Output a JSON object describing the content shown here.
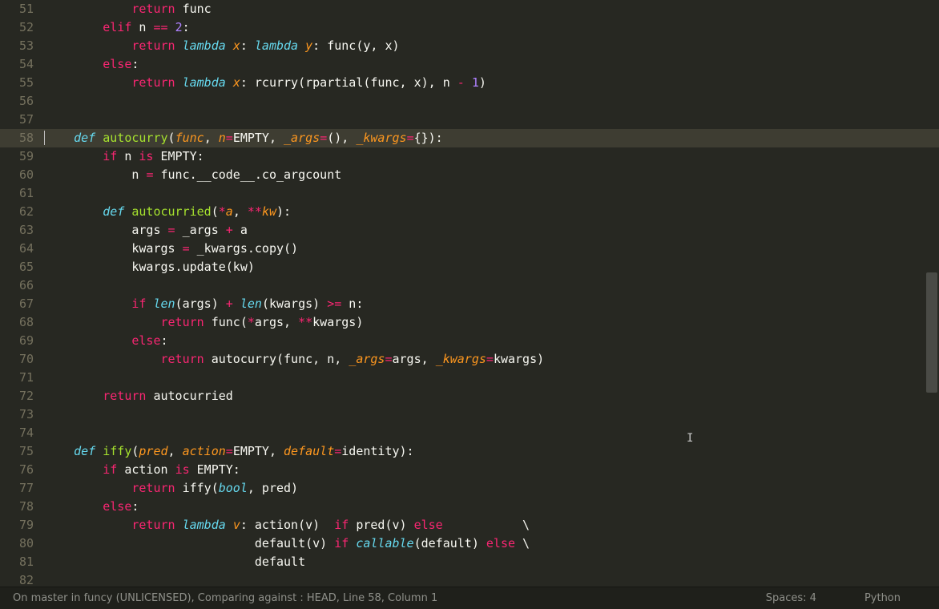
{
  "status": {
    "left": "On master in funcy (UNLICENSED), Comparing against : HEAD, Line 58, Column 1",
    "spaces": "Spaces: 4",
    "syntax": "Python"
  },
  "first_line_number": 51,
  "highlight_line": 58,
  "lines": [
    [
      [
        "pl",
        "            "
      ],
      [
        "kw",
        "return"
      ],
      [
        "pl",
        " func"
      ]
    ],
    [
      [
        "pl",
        "        "
      ],
      [
        "kw",
        "elif"
      ],
      [
        "pl",
        " n "
      ],
      [
        "op",
        "=="
      ],
      [
        "pl",
        " "
      ],
      [
        "nu",
        "2"
      ],
      [
        "pl",
        ":"
      ]
    ],
    [
      [
        "pl",
        "            "
      ],
      [
        "kw",
        "return"
      ],
      [
        "pl",
        " "
      ],
      [
        "kwit",
        "lambda"
      ],
      [
        "pl",
        " "
      ],
      [
        "pr",
        "x"
      ],
      [
        "pl",
        ": "
      ],
      [
        "kwit",
        "lambda"
      ],
      [
        "pl",
        " "
      ],
      [
        "pr",
        "y"
      ],
      [
        "pl",
        ": func(y, x)"
      ]
    ],
    [
      [
        "pl",
        "        "
      ],
      [
        "kw",
        "else"
      ],
      [
        "pl",
        ":"
      ]
    ],
    [
      [
        "pl",
        "            "
      ],
      [
        "kw",
        "return"
      ],
      [
        "pl",
        " "
      ],
      [
        "kwit",
        "lambda"
      ],
      [
        "pl",
        " "
      ],
      [
        "pr",
        "x"
      ],
      [
        "pl",
        ": rcurry(rpartial(func, x), n "
      ],
      [
        "op",
        "-"
      ],
      [
        "pl",
        " "
      ],
      [
        "nu",
        "1"
      ],
      [
        "pl",
        ")"
      ]
    ],
    [
      [
        "pl",
        ""
      ]
    ],
    [
      [
        "pl",
        ""
      ]
    ],
    [
      [
        "pl",
        "    "
      ],
      [
        "kwit",
        "def"
      ],
      [
        "pl",
        " "
      ],
      [
        "fn",
        "autocurry"
      ],
      [
        "pl",
        "("
      ],
      [
        "pr",
        "func"
      ],
      [
        "pl",
        ", "
      ],
      [
        "pr",
        "n"
      ],
      [
        "op",
        "="
      ],
      [
        "pl",
        "EMPTY, "
      ],
      [
        "pr",
        "_args"
      ],
      [
        "op",
        "="
      ],
      [
        "pl",
        "(), "
      ],
      [
        "pr",
        "_kwargs"
      ],
      [
        "op",
        "="
      ],
      [
        "pl",
        "{}):"
      ]
    ],
    [
      [
        "pl",
        "        "
      ],
      [
        "kw",
        "if"
      ],
      [
        "pl",
        " n "
      ],
      [
        "kw",
        "is"
      ],
      [
        "pl",
        " EMPTY:"
      ]
    ],
    [
      [
        "pl",
        "            n "
      ],
      [
        "op",
        "="
      ],
      [
        "pl",
        " func.__code__.co_argcount"
      ]
    ],
    [
      [
        "pl",
        ""
      ]
    ],
    [
      [
        "pl",
        "        "
      ],
      [
        "kwit",
        "def"
      ],
      [
        "pl",
        " "
      ],
      [
        "fn",
        "autocurried"
      ],
      [
        "pl",
        "("
      ],
      [
        "op",
        "*"
      ],
      [
        "pr",
        "a"
      ],
      [
        "pl",
        ", "
      ],
      [
        "op",
        "**"
      ],
      [
        "pr",
        "kw"
      ],
      [
        "pl",
        "):"
      ]
    ],
    [
      [
        "pl",
        "            args "
      ],
      [
        "op",
        "="
      ],
      [
        "pl",
        " _args "
      ],
      [
        "op",
        "+"
      ],
      [
        "pl",
        " a"
      ]
    ],
    [
      [
        "pl",
        "            kwargs "
      ],
      [
        "op",
        "="
      ],
      [
        "pl",
        " _kwargs.copy()"
      ]
    ],
    [
      [
        "pl",
        "            kwargs.update(kw)"
      ]
    ],
    [
      [
        "pl",
        ""
      ]
    ],
    [
      [
        "pl",
        "            "
      ],
      [
        "kw",
        "if"
      ],
      [
        "pl",
        " "
      ],
      [
        "bi",
        "len"
      ],
      [
        "pl",
        "(args) "
      ],
      [
        "op",
        "+"
      ],
      [
        "pl",
        " "
      ],
      [
        "bi",
        "len"
      ],
      [
        "pl",
        "(kwargs) "
      ],
      [
        "op",
        ">="
      ],
      [
        "pl",
        " n:"
      ]
    ],
    [
      [
        "pl",
        "                "
      ],
      [
        "kw",
        "return"
      ],
      [
        "pl",
        " func("
      ],
      [
        "op",
        "*"
      ],
      [
        "pl",
        "args, "
      ],
      [
        "op",
        "**"
      ],
      [
        "pl",
        "kwargs)"
      ]
    ],
    [
      [
        "pl",
        "            "
      ],
      [
        "kw",
        "else"
      ],
      [
        "pl",
        ":"
      ]
    ],
    [
      [
        "pl",
        "                "
      ],
      [
        "kw",
        "return"
      ],
      [
        "pl",
        " autocurry(func, n, "
      ],
      [
        "pr",
        "_args"
      ],
      [
        "op",
        "="
      ],
      [
        "pl",
        "args, "
      ],
      [
        "pr",
        "_kwargs"
      ],
      [
        "op",
        "="
      ],
      [
        "pl",
        "kwargs)"
      ]
    ],
    [
      [
        "pl",
        ""
      ]
    ],
    [
      [
        "pl",
        "        "
      ],
      [
        "kw",
        "return"
      ],
      [
        "pl",
        " autocurried"
      ]
    ],
    [
      [
        "pl",
        ""
      ]
    ],
    [
      [
        "pl",
        ""
      ]
    ],
    [
      [
        "pl",
        "    "
      ],
      [
        "kwit",
        "def"
      ],
      [
        "pl",
        " "
      ],
      [
        "fn",
        "iffy"
      ],
      [
        "pl",
        "("
      ],
      [
        "pr",
        "pred"
      ],
      [
        "pl",
        ", "
      ],
      [
        "pr",
        "action"
      ],
      [
        "op",
        "="
      ],
      [
        "pl",
        "EMPTY, "
      ],
      [
        "pr",
        "default"
      ],
      [
        "op",
        "="
      ],
      [
        "pl",
        "identity):"
      ]
    ],
    [
      [
        "pl",
        "        "
      ],
      [
        "kw",
        "if"
      ],
      [
        "pl",
        " action "
      ],
      [
        "kw",
        "is"
      ],
      [
        "pl",
        " EMPTY:"
      ]
    ],
    [
      [
        "pl",
        "            "
      ],
      [
        "kw",
        "return"
      ],
      [
        "pl",
        " iffy("
      ],
      [
        "bi",
        "bool"
      ],
      [
        "pl",
        ", pred)"
      ]
    ],
    [
      [
        "pl",
        "        "
      ],
      [
        "kw",
        "else"
      ],
      [
        "pl",
        ":"
      ]
    ],
    [
      [
        "pl",
        "            "
      ],
      [
        "kw",
        "return"
      ],
      [
        "pl",
        " "
      ],
      [
        "kwit",
        "lambda"
      ],
      [
        "pl",
        " "
      ],
      [
        "pr",
        "v"
      ],
      [
        "pl",
        ": action(v)  "
      ],
      [
        "kw",
        "if"
      ],
      [
        "pl",
        " pred(v) "
      ],
      [
        "kw",
        "else"
      ],
      [
        "pl",
        "           \\"
      ]
    ],
    [
      [
        "pl",
        "                             default(v) "
      ],
      [
        "kw",
        "if"
      ],
      [
        "pl",
        " "
      ],
      [
        "bi",
        "callable"
      ],
      [
        "pl",
        "(default) "
      ],
      [
        "kw",
        "else"
      ],
      [
        "pl",
        " \\"
      ]
    ],
    [
      [
        "pl",
        "                             default"
      ]
    ],
    [
      [
        "pl",
        ""
      ]
    ]
  ]
}
